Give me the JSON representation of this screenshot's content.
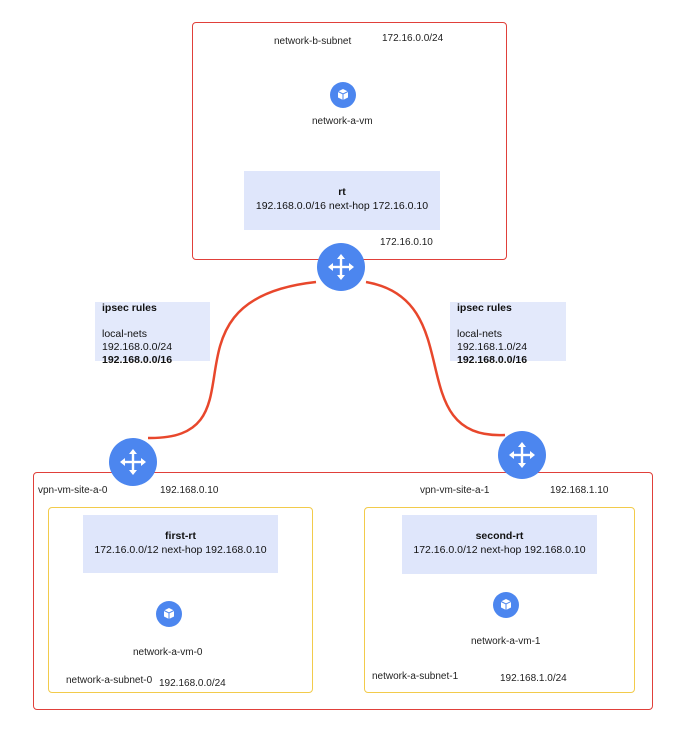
{
  "top": {
    "subnet_name": "network-b-subnet",
    "subnet_cidr": "172.16.0.0/24",
    "vm_name": "network-a-vm",
    "route_title": "rt",
    "route_rule": "192.168.0.0/16 next-hop 172.16.0.10",
    "router_ip": "172.16.0.10"
  },
  "ipsec_left": {
    "title": "ipsec rules",
    "heading": "local-nets",
    "net1": "192.168.0.0/24",
    "net2": "192.168.0.0/16"
  },
  "ipsec_right": {
    "title": "ipsec rules",
    "heading": "local-nets",
    "net1": "192.168.1.0/24",
    "net2": "192.168.0.0/16"
  },
  "site_a0": {
    "vpn_name": "vpn-vm-site-a-0",
    "vpn_ip": "192.168.0.10",
    "route_title": "first-rt",
    "route_rule": "172.16.0.0/12 next-hop 192.168.0.10",
    "vm_name": "network-a-vm-0",
    "subnet_name": "network-a-subnet-0",
    "subnet_cidr": "192.168.0.0/24"
  },
  "site_a1": {
    "vpn_name": "vpn-vm-site-a-1",
    "vpn_ip": "192.168.1.10",
    "route_title": "second-rt",
    "route_rule": "172.16.0.0/12 next-hop 192.168.0.10",
    "vm_name": "network-a-vm-1",
    "subnet_name": "network-a-subnet-1",
    "subnet_cidr": "192.168.1.0/24"
  },
  "icons": {
    "router": "router-icon",
    "vm": "compute-vm-icon"
  },
  "colors": {
    "network_border": "#e0403a",
    "subnet_border": "#f2cb4b",
    "tunnel": "#e8472c",
    "icon_fill": "#4c86ef",
    "route_fill": "#dfe6fb"
  }
}
